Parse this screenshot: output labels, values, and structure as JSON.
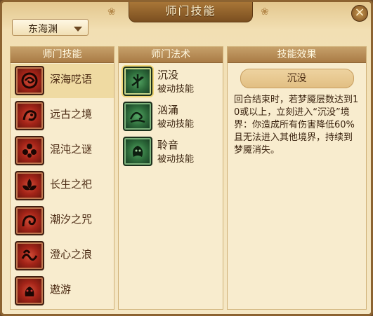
{
  "window": {
    "title": "师门技能",
    "close_label": "×"
  },
  "faction_dropdown": {
    "selected": "东海渊"
  },
  "panels": {
    "faction_skills": {
      "header": "师门技能",
      "items": [
        {
          "name": "深海呓语",
          "icon": "whirlpool-emblem-icon",
          "selected": true
        },
        {
          "name": "远古之境",
          "icon": "dragon-emblem-icon"
        },
        {
          "name": "混沌之谜",
          "icon": "flower-emblem-icon"
        },
        {
          "name": "长生之祀",
          "icon": "lotus-emblem-icon"
        },
        {
          "name": "潮汐之咒",
          "icon": "swirl-emblem-icon"
        },
        {
          "name": "澄心之浪",
          "icon": "wave-emblem-icon"
        },
        {
          "name": "遨游",
          "icon": "beast-emblem-icon"
        }
      ]
    },
    "faction_spells": {
      "header": "师门法术",
      "items": [
        {
          "name": "沉没",
          "type": "被动技能",
          "icon": "trident-icon",
          "selected": true
        },
        {
          "name": "汹涌",
          "type": "被动技能",
          "icon": "wave-icon"
        },
        {
          "name": "聆音",
          "type": "被动技能",
          "icon": "creature-icon"
        }
      ]
    },
    "skill_effect": {
      "header": "技能效果",
      "title": "沉没",
      "description": "回合结束时，若梦魇层数达到10或以上，立刻进入“沉没”境界：你造成所有伤害降低60%且无法进入其他境界，持续到梦魇消失。"
    }
  },
  "colors": {
    "frame": "#8c6331",
    "panel_header": "#a97b45",
    "selected_row": "#efdaa2",
    "red_icon": "#a42418",
    "green_icon": "#2d6b3a"
  }
}
